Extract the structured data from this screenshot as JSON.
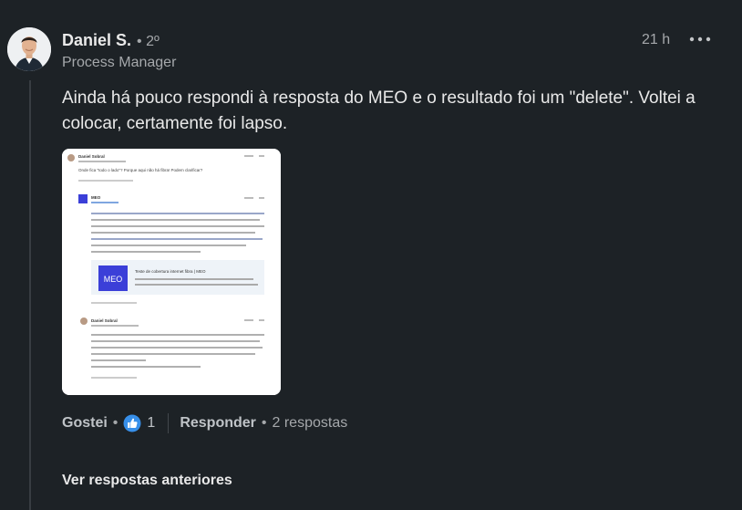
{
  "comment": {
    "author": "Daniel S.",
    "degree": "• 2º",
    "headline": "Process Manager",
    "time": "21 h",
    "more_icon": "more-horizontal-icon",
    "text": "Ainda há pouco respondi à resposta do MEO e o resultado foi um \"delete\". Voltei a colocar, certamente foi lapso."
  },
  "attachment": {
    "post1_author": "Daniel Sobral",
    "post1_text": "Onde fica \"todo o lado\"? Porque aqui não há fibra! Podem clarificar?",
    "meo_name": "MEO",
    "meo_card_title": "Teste de cobertura internet fibra | MEO",
    "meo_logo": "MEO",
    "reply_author": "Daniel Sobral"
  },
  "actions": {
    "like_label": "Gostei",
    "sep": "•",
    "like_icon": "thumbs-up-icon",
    "like_count": "1",
    "reply_label": "Responder",
    "replies_count": "2 respostas"
  },
  "footer": {
    "see_previous": "Ver respostas anteriores"
  },
  "colors": {
    "background": "#1d2226",
    "like_blue": "#378fe9",
    "meo_blue": "#3b3fd8"
  }
}
